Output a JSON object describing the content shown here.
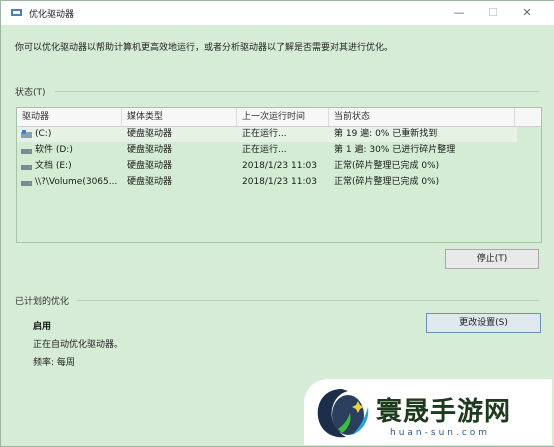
{
  "window": {
    "title": "优化驱动器",
    "minimize": "—",
    "maximize": "☐",
    "close": "✕"
  },
  "description": "你可以优化驱动器以帮助计算机更高效地运行，或者分析驱动器以了解是否需要对其进行优化。",
  "status_section": "状态(T)",
  "table": {
    "headers": [
      "驱动器",
      "媒体类型",
      "上一次运行时间",
      "当前状态"
    ],
    "rows": [
      {
        "drive": "(C:)",
        "media": "硬盘驱动器",
        "last_run": "正在运行...",
        "status": "第 19 遍: 0% 已重新找到",
        "icon": "windows-drive-icon"
      },
      {
        "drive": "软件 (D:)",
        "media": "硬盘驱动器",
        "last_run": "正在运行...",
        "status": "第 1 遍: 30% 已进行碎片整理",
        "icon": "hard-drive-icon"
      },
      {
        "drive": "文档 (E:)",
        "media": "硬盘驱动器",
        "last_run": "2018/1/23 11:03",
        "status": "正常(碎片整理已完成 0%)",
        "icon": "hard-drive-icon"
      },
      {
        "drive": "\\\\?\\Volume(3065...",
        "media": "硬盘驱动器",
        "last_run": "2018/1/23 11:03",
        "status": "正常(碎片整理已完成 0%)",
        "icon": "hard-drive-icon"
      }
    ]
  },
  "buttons": {
    "stop": "停止(T)",
    "change_settings": "更改设置(S)"
  },
  "scheduled": {
    "section": "已计划的优化",
    "state": "启用",
    "auto_text": "正在自动优化驱动器。",
    "frequency": "频率: 每周"
  },
  "watermark": {
    "brand": "寰晟手游网",
    "url": "huan-sun.com"
  },
  "colors": {
    "background": "#d6ecd6",
    "accent": "#6b8fb8"
  }
}
